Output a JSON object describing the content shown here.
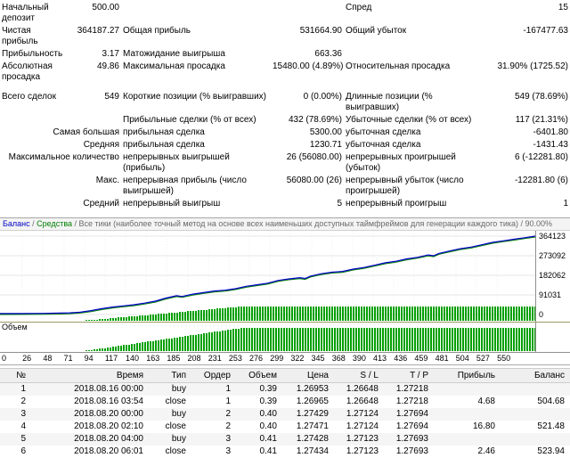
{
  "report": {
    "stats_rows": [
      {
        "l1": "Начальный депозит",
        "v1": "500.00",
        "l2": "",
        "v2": "",
        "l3": "Спред",
        "v3": "15"
      },
      {
        "l1": "Чистая прибыль",
        "v1": "364187.27",
        "l2": "Общая прибыль",
        "v2": "531664.90",
        "l3": "Общий убыток",
        "v3": "-167477.63"
      },
      {
        "l1": "Прибыльность",
        "v1": "3.17",
        "l2": "Матожидание выигрыша",
        "v2": "663.36",
        "l3": "",
        "v3": ""
      },
      {
        "l1": "Абсолютная просадка",
        "v1": "49.86",
        "l2": "Максимальная просадка",
        "v2": "15480.00 (4.89%)",
        "l3": "Относительная просадка",
        "v3": "31.90% (1725.52)"
      },
      {
        "l1": "Всего сделок",
        "v1": "549",
        "l2": "Короткие позиции (% выигравших)",
        "v2": "0 (0.00%)",
        "l3": "Длинные позиции (% выигравших)",
        "v3": "549 (78.69%)",
        "gap": true
      },
      {
        "l1": "",
        "v1": "",
        "l2": "Прибыльные сделки (% от всех)",
        "v2": "432 (78.69%)",
        "l3": "Убыточные сделки (% от всех)",
        "v3": "117 (21.31%)"
      },
      {
        "l1": "Самая большая",
        "merge": true,
        "l2": "прибыльная сделка",
        "v2": "5300.00",
        "l3": "убыточная сделка",
        "v3": "-6401.80"
      },
      {
        "l1": "Средняя",
        "merge": true,
        "l2": "прибыльная сделка",
        "v2": "1230.71",
        "l3": "убыточная сделка",
        "v3": "-1431.43"
      },
      {
        "l1": "Максимальное количество",
        "merge": true,
        "l2": "непрерывных выигрышей (прибыль)",
        "v2": "26 (56080.00)",
        "l3": "непрерывных проигрышей (убыток)",
        "v3": "6 (-12281.80)"
      },
      {
        "l1": "Макс.",
        "merge": true,
        "l2": "непрерывная прибыль (число выигрышей)",
        "v2": "56080.00 (26)",
        "l3": "непрерывный убыток (число проигрышей)",
        "v3": "-12281.80 (6)"
      },
      {
        "l1": "Средний",
        "merge": true,
        "l2": "непрерывный выигрыш",
        "v2": "5",
        "l3": "непрерывный проигрыш",
        "v3": "1"
      }
    ]
  },
  "chart_data": {
    "type": "line",
    "header": {
      "balance": "Баланс",
      "sep": " / ",
      "equity": "Средства",
      "rest": "Все тики (наиболее точный метод на основе всех наименьших доступных таймфреймов для генерации каждого тика)",
      "quality": "90.00%"
    },
    "volume_label": "Объем",
    "y_ticks": [
      "364123",
      "273092",
      "182062",
      "91031",
      "0"
    ],
    "x_ticks": [
      "0",
      "26",
      "48",
      "71",
      "94",
      "117",
      "140",
      "163",
      "185",
      "208",
      "231",
      "253",
      "276",
      "299",
      "322",
      "345",
      "368",
      "390",
      "413",
      "436",
      "459",
      "481",
      "504",
      "527",
      "550"
    ],
    "y_range": [
      0,
      364123
    ],
    "balance_points": [
      [
        0,
        0.012
      ],
      [
        0.04,
        0.013
      ],
      [
        0.08,
        0.015
      ],
      [
        0.11,
        0.018
      ],
      [
        0.13,
        0.022
      ],
      [
        0.15,
        0.03
      ],
      [
        0.17,
        0.05
      ],
      [
        0.19,
        0.075
      ],
      [
        0.21,
        0.095
      ],
      [
        0.23,
        0.11
      ],
      [
        0.25,
        0.125
      ],
      [
        0.27,
        0.145
      ],
      [
        0.29,
        0.17
      ],
      [
        0.31,
        0.21
      ],
      [
        0.33,
        0.24
      ],
      [
        0.34,
        0.23
      ],
      [
        0.36,
        0.26
      ],
      [
        0.38,
        0.28
      ],
      [
        0.4,
        0.3
      ],
      [
        0.42,
        0.31
      ],
      [
        0.44,
        0.33
      ],
      [
        0.46,
        0.36
      ],
      [
        0.48,
        0.38
      ],
      [
        0.5,
        0.4
      ],
      [
        0.52,
        0.435
      ],
      [
        0.54,
        0.455
      ],
      [
        0.56,
        0.47
      ],
      [
        0.57,
        0.46
      ],
      [
        0.58,
        0.49
      ],
      [
        0.6,
        0.52
      ],
      [
        0.62,
        0.54
      ],
      [
        0.64,
        0.55
      ],
      [
        0.66,
        0.58
      ],
      [
        0.68,
        0.6
      ],
      [
        0.7,
        0.63
      ],
      [
        0.72,
        0.66
      ],
      [
        0.74,
        0.68
      ],
      [
        0.76,
        0.71
      ],
      [
        0.78,
        0.73
      ],
      [
        0.8,
        0.76
      ],
      [
        0.81,
        0.75
      ],
      [
        0.82,
        0.78
      ],
      [
        0.84,
        0.81
      ],
      [
        0.86,
        0.84
      ],
      [
        0.88,
        0.86
      ],
      [
        0.9,
        0.89
      ],
      [
        0.92,
        0.92
      ],
      [
        0.94,
        0.94
      ],
      [
        0.96,
        0.96
      ],
      [
        0.98,
        0.98
      ],
      [
        1,
        1
      ]
    ],
    "bars": {
      "start_frac": 0.155,
      "ramp_end_frac": 0.45
    },
    "colors": {
      "balance": "#0000c8",
      "equity": "#008000",
      "bars": "#00a000",
      "grid_h": "#e6e6e6",
      "grid_v": "#efefef"
    }
  },
  "trades": {
    "columns": [
      "№",
      "Время",
      "Тип",
      "Ордер",
      "Объем",
      "Цена",
      "S / L",
      "T / P",
      "Прибыль",
      "Баланс"
    ],
    "rows": [
      [
        "1",
        "2018.08.16 00:00",
        "buy",
        "1",
        "0.39",
        "1.26953",
        "1.26648",
        "1.27218",
        "",
        ""
      ],
      [
        "2",
        "2018.08.16 03:54",
        "close",
        "1",
        "0.39",
        "1.26965",
        "1.26648",
        "1.27218",
        "4.68",
        "504.68"
      ],
      [
        "3",
        "2018.08.20 00:00",
        "buy",
        "2",
        "0.40",
        "1.27429",
        "1.27124",
        "1.27694",
        "",
        ""
      ],
      [
        "4",
        "2018.08.20 02:10",
        "close",
        "2",
        "0.40",
        "1.27471",
        "1.27124",
        "1.27694",
        "16.80",
        "521.48"
      ],
      [
        "5",
        "2018.08.20 04:00",
        "buy",
        "3",
        "0.41",
        "1.27428",
        "1.27123",
        "1.27693",
        "",
        ""
      ],
      [
        "6",
        "2018.08.20 06:01",
        "close",
        "3",
        "0.41",
        "1.27434",
        "1.27123",
        "1.27693",
        "2.46",
        "523.94"
      ]
    ]
  }
}
